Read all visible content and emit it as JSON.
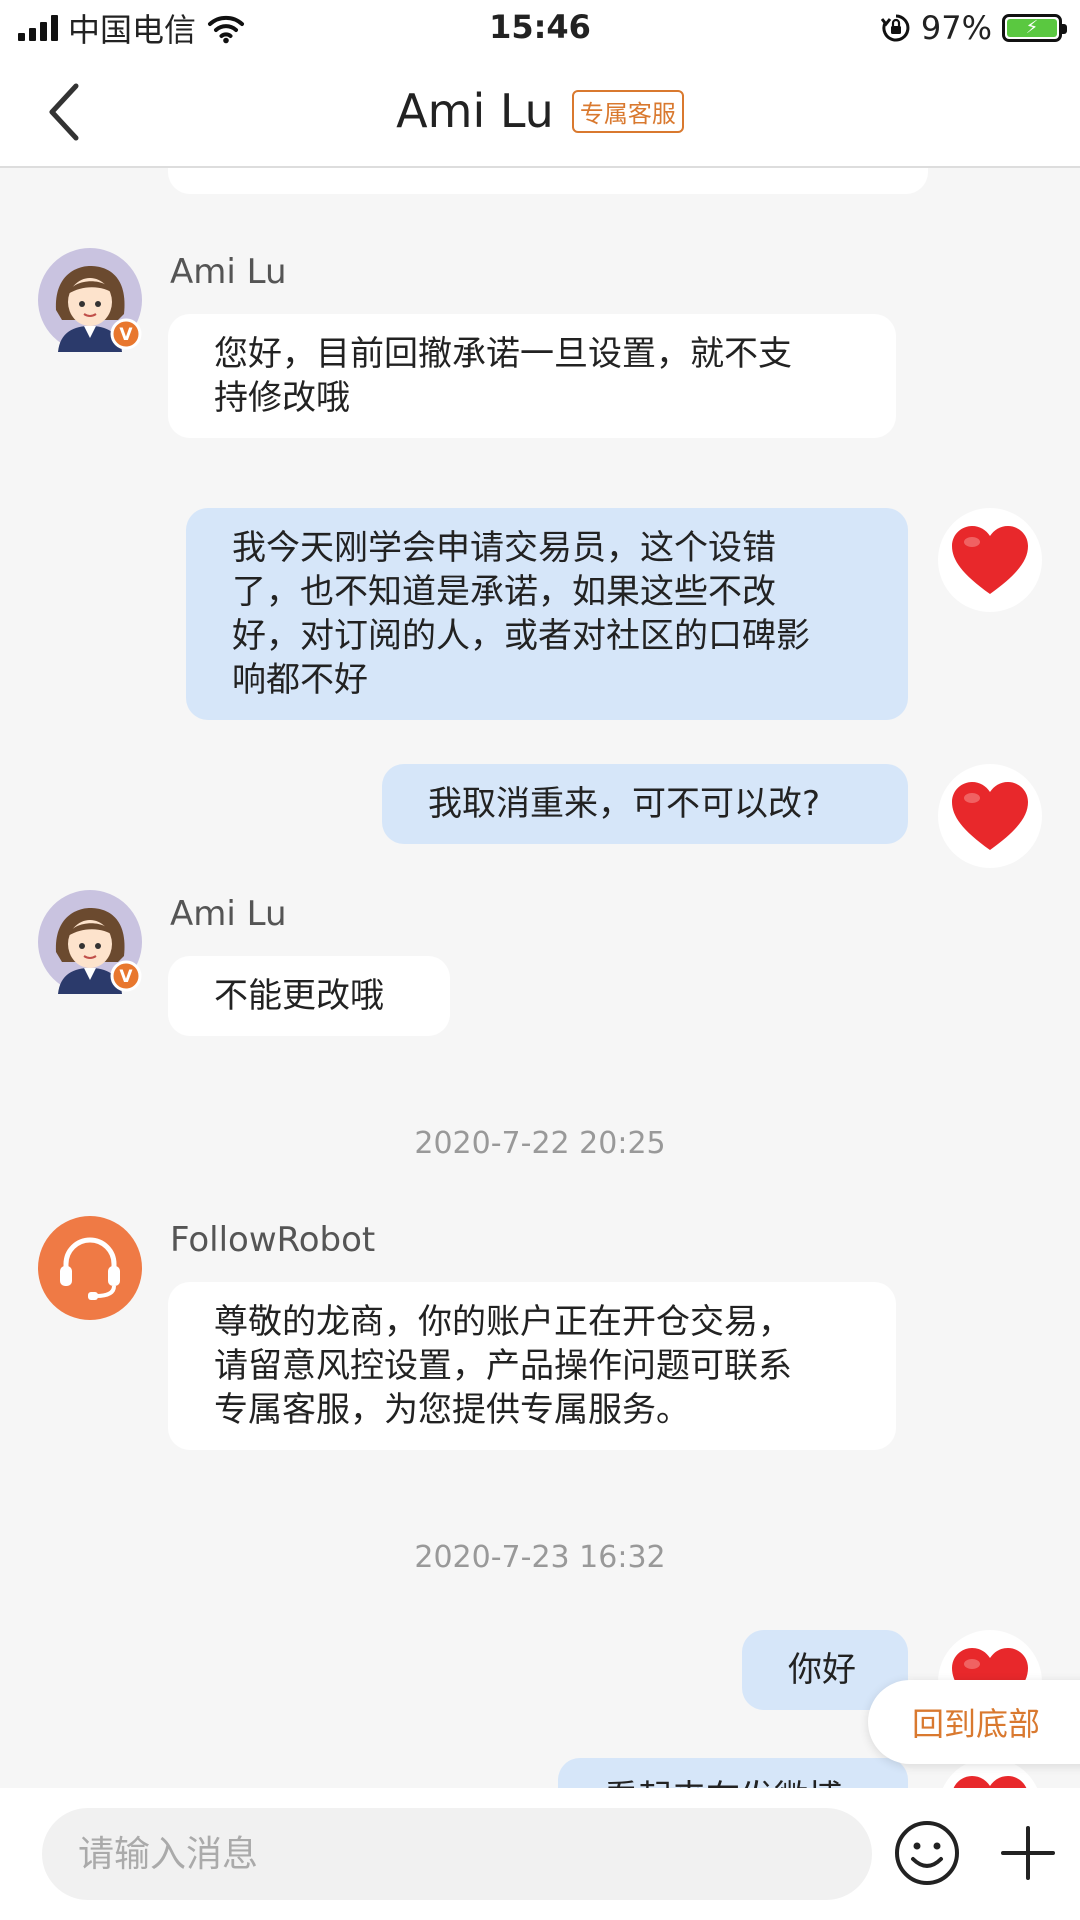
{
  "status_bar": {
    "carrier": "中国电信",
    "time": "15:46",
    "battery": "97%"
  },
  "nav": {
    "title": "Ami Lu",
    "badge": "专属客服"
  },
  "messages": [
    {
      "sender": "Ami Lu",
      "text": "您好，目前回撤承诺一旦设置，就不支\n持修改哦"
    },
    {
      "text": "我今天刚学会申请交易员，这个设错\n了，也不知道是承诺，如果这些不改\n好，对订阅的人，或者对社区的口碑影\n响都不好"
    },
    {
      "text": "我取消重来，可不可以改?"
    },
    {
      "sender": "Ami Lu",
      "text": "不能更改哦"
    },
    {
      "sender": "FollowRobot",
      "text": "尊敬的龙商，你的账户正在开仓交易，\n请留意风控设置，产品操作问题可联系\n专属客服，为您提供专属服务。"
    },
    {
      "text": "你好"
    },
    {
      "text": "看起来在发微博"
    }
  ],
  "timestamps": [
    "2020-7-22 20:25",
    "2020-7-23 16:32"
  ],
  "back_to_bottom": "回到底部",
  "input": {
    "placeholder": "请输入消息"
  },
  "colors": {
    "accent": "#d9792f",
    "outgoing_bubble": "#d6e6f9",
    "incoming_bubble": "#ffffff",
    "robot_avatar": "#ef7a45",
    "heart": "#e8282b"
  }
}
